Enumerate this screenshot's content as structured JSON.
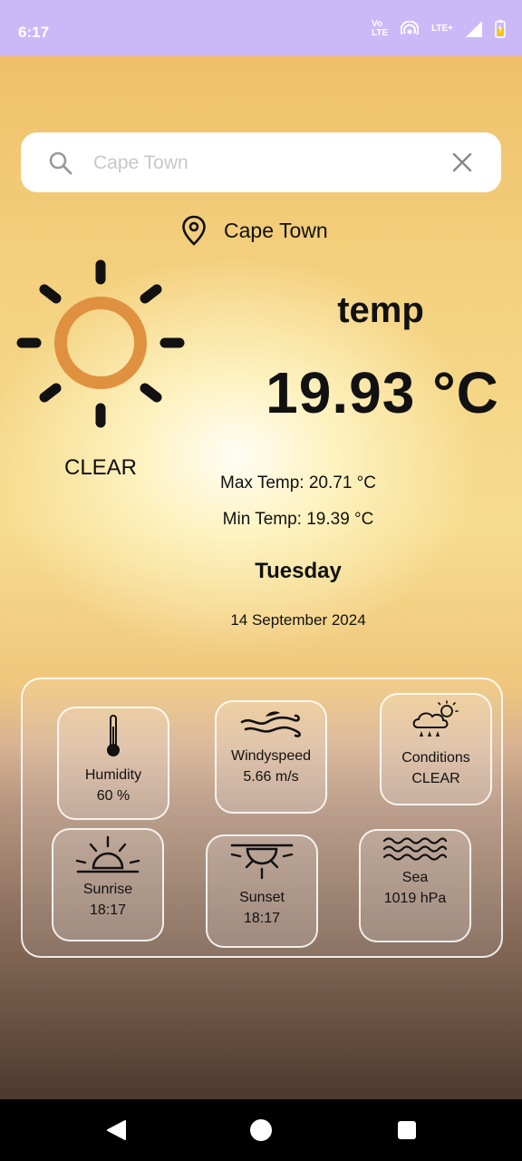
{
  "status_bar": {
    "time": "6:17",
    "volte_label": "Vo LTE",
    "network_label": "LTE+"
  },
  "search": {
    "placeholder": "Cape Town",
    "value": ""
  },
  "location": {
    "name": "Cape Town"
  },
  "weather": {
    "condition": "CLEAR",
    "temp_label": "temp",
    "temp_value": "19.93 °C",
    "max_temp": "Max Temp: 20.71 °C",
    "min_temp": "Min Temp: 19.39 °C",
    "day": "Tuesday",
    "date": "14 September 2024"
  },
  "details": {
    "humidity": {
      "label": "Humidity",
      "value": "60 %",
      "icon": "thermometer-icon"
    },
    "wind": {
      "label": "Windyspeed",
      "value": "5.66 m/s",
      "icon": "wind-icon"
    },
    "conditions": {
      "label": "Conditions",
      "value": "CLEAR",
      "icon": "cloud-sun-rain-icon"
    },
    "sunrise": {
      "label": "Sunrise",
      "value": "18:17",
      "icon": "sunrise-icon"
    },
    "sunset": {
      "label": "Sunset",
      "value": "18:17",
      "icon": "sunset-icon"
    },
    "sea": {
      "label": "Sea",
      "value": "1019 hPa",
      "icon": "waves-icon"
    }
  },
  "colors": {
    "status_bar": "#cbb8f7",
    "sun_ring": "#e0913f",
    "text": "#111111"
  }
}
